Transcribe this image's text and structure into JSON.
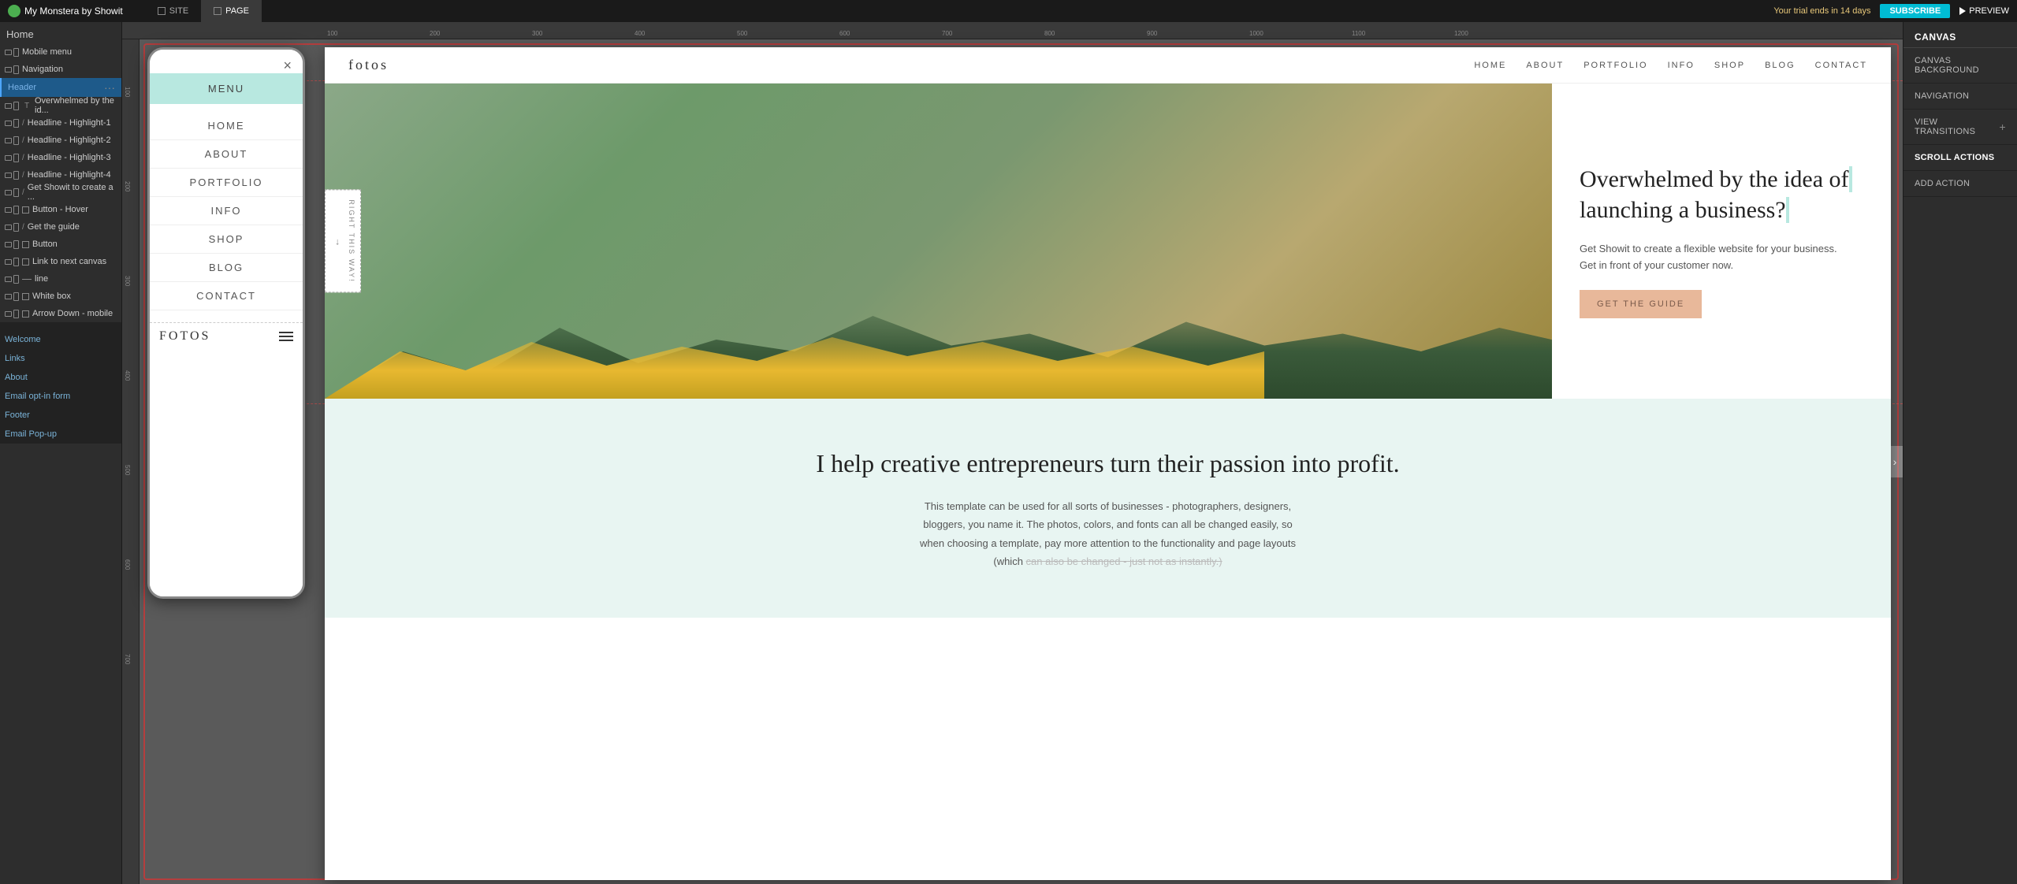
{
  "app": {
    "logo": "My Monstera by Showit",
    "trial_text": "Your trial ends in 14 days",
    "subscribe_label": "SUBSCRIBE",
    "preview_label": "PREVIEW"
  },
  "topbar": {
    "site_tab": "SITE",
    "page_tab": "PAGE"
  },
  "left_panel": {
    "home_label": "Home",
    "items": [
      {
        "label": "Mobile menu",
        "type": "both",
        "id": "mobile-menu"
      },
      {
        "label": "Navigation",
        "type": "both",
        "id": "navigation"
      },
      {
        "label": "Header",
        "type": "section",
        "id": "header"
      },
      {
        "label": "Overwhelmed by the id...",
        "type": "text",
        "id": "overwhelmed"
      },
      {
        "label": "Headline - Highlight-1",
        "type": "text-slash",
        "id": "headline-1"
      },
      {
        "label": "Headline - Highlight-2",
        "type": "text-slash",
        "id": "headline-2"
      },
      {
        "label": "Headline - Highlight-3",
        "type": "text-slash",
        "id": "headline-3"
      },
      {
        "label": "Headline - Highlight-4",
        "type": "text-slash",
        "id": "headline-4"
      },
      {
        "label": "Get Showit to create a ...",
        "type": "text-slash",
        "id": "get-showit"
      },
      {
        "label": "Button - Hover",
        "type": "both-sq",
        "id": "button-hover"
      },
      {
        "label": "Get the guide",
        "type": "text-slash",
        "id": "get-the-guide"
      },
      {
        "label": "Button",
        "type": "both-sq",
        "id": "button"
      },
      {
        "label": "Link to next canvas",
        "type": "both-sq",
        "id": "link-next"
      },
      {
        "label": "line",
        "type": "line",
        "id": "line"
      },
      {
        "label": "White box",
        "type": "both-sq",
        "id": "white-box"
      },
      {
        "label": "Arrow Down - mobile",
        "type": "both-sq",
        "id": "arrow-down"
      }
    ],
    "sections": [
      {
        "label": "Welcome",
        "id": "welcome"
      },
      {
        "label": "Links",
        "id": "links"
      },
      {
        "label": "About",
        "id": "about"
      },
      {
        "label": "Email opt-in form",
        "id": "email-opt-in"
      },
      {
        "label": "Footer",
        "id": "footer"
      },
      {
        "label": "Email Pop-up",
        "id": "email-popup"
      }
    ]
  },
  "right_panel": {
    "canvas_label": "CANVAS",
    "canvas_bg_label": "CANVAS BACKGROUND",
    "navigation_label": "NAVIGATION",
    "view_transitions_label": "VIEW TRANSITIONS",
    "scroll_actions_label": "SCROLL ACTIONS",
    "add_action_label": "ADD ACTION"
  },
  "mobile_menu": {
    "close": "×",
    "menu_label": "MENU",
    "items": [
      "HOME",
      "ABOUT",
      "PORTFOLIO",
      "INFO",
      "SHOP",
      "BLOG",
      "CONTACT"
    ]
  },
  "mobile_content": {
    "logo": "FOTOS",
    "hero_title": "Overwhelmed by the idea of launching a business?",
    "sub_text": "Get Showit to create a flexible website for your business. Get in front of your customer now.",
    "cta_label": "GET THE GUIDE"
  },
  "desktop": {
    "logo": "fotos",
    "nav_items": [
      "HOME",
      "ABOUT",
      "PORTFOLIO",
      "INFO",
      "SHOP",
      "BLOG",
      "CONTACT"
    ],
    "hero_title_1": "Overwhelmed by the idea of",
    "hero_title_2": "launching a business?",
    "hero_subtitle_1": "Get Showit to create a flexible website for your business.",
    "hero_subtitle_2": "Get in front of your customer now.",
    "hero_cta": "GET THE GUIDE",
    "vertical_tab_text": "RIGHT THIS WAY!",
    "section2_title": "I help creative entrepreneurs turn their passion into profit.",
    "section2_text": "This template can be used for all sorts of businesses - photographers, designers, bloggers, you name it. The photos, colors, and fonts can all be changed easily, so when choosing a template, pay more attention to the functionality and page layouts (which can also be changed - just not as instantly.)",
    "ruler_marks": [
      "100",
      "200",
      "300",
      "400",
      "500",
      "600",
      "700",
      "800",
      "900",
      "1000",
      "1100",
      "1200"
    ]
  }
}
